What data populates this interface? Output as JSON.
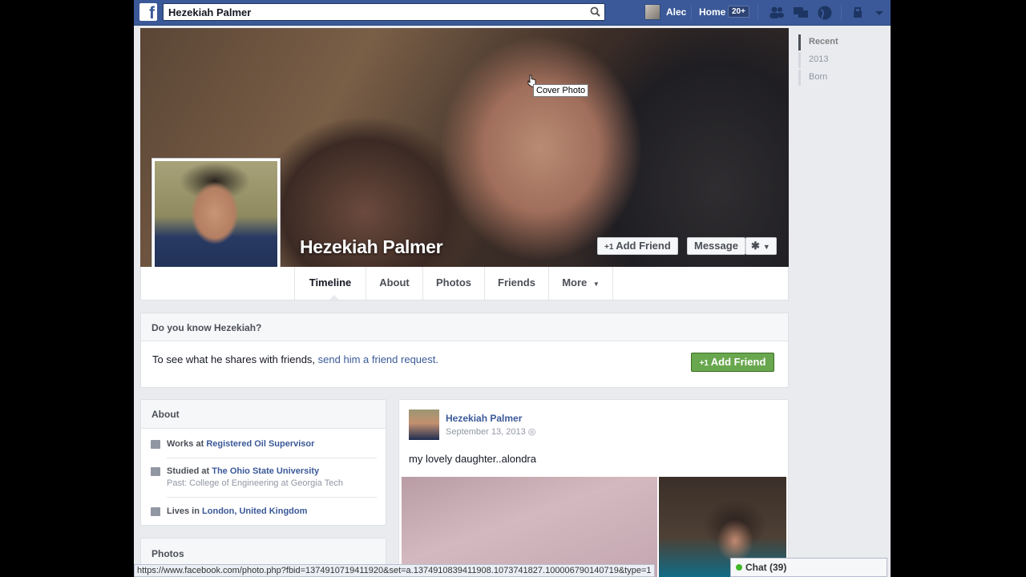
{
  "topbar": {
    "search_value": "Hezekiah Palmer",
    "user_name": "Alec",
    "home_label": "Home",
    "notification_count": "20+"
  },
  "cover": {
    "tooltip": "Cover Photo",
    "profile_name": "Hezekiah Palmer",
    "add_friend_label": "Add Friend",
    "message_label": "Message"
  },
  "nav": {
    "tabs": [
      {
        "label": "Timeline"
      },
      {
        "label": "About"
      },
      {
        "label": "Photos"
      },
      {
        "label": "Friends"
      },
      {
        "label": "More"
      }
    ]
  },
  "know_box": {
    "title": "Do you know Hezekiah?",
    "text": "To see what he shares with friends, ",
    "link": "send him a friend request.",
    "button": "Add Friend"
  },
  "about": {
    "title": "About",
    "works_prefix": "Works at ",
    "works": "Registered Oil Supervisor",
    "studied_prefix": "Studied at ",
    "studied": "The Ohio State University",
    "studied_past": "Past: College of Engineering at Georgia Tech",
    "lives_prefix": "Lives in ",
    "lives": "London, United Kingdom"
  },
  "photos": {
    "title": "Photos"
  },
  "post": {
    "author": "Hezekiah Palmer",
    "date": "September 13, 2013",
    "text": "my lovely daughter..alondra"
  },
  "rail": {
    "items": [
      {
        "label": "Recent"
      },
      {
        "label": "2013"
      },
      {
        "label": "Born"
      }
    ]
  },
  "status_url": "https://www.facebook.com/photo.php?fbid=1374910719411920&set=a.1374910839411908.1073741827.100006790140719&type=1",
  "chat": {
    "label": "Chat (39)"
  }
}
